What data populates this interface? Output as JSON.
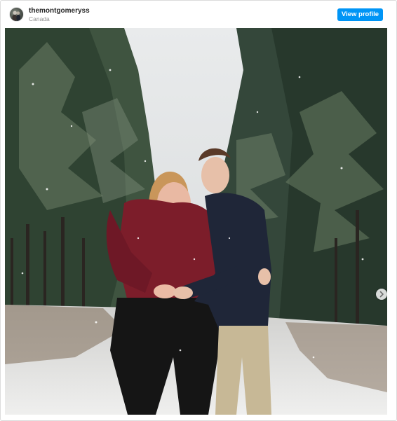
{
  "post": {
    "username": "themontgomeryss",
    "location": "Canada",
    "view_profile_label": "View profile"
  },
  "icons": {
    "avatar": "profile-photo",
    "next": "chevron-right-icon"
  },
  "colors": {
    "button_blue": "#0095f6",
    "username": "#262626",
    "location": "#8e8e8e"
  }
}
